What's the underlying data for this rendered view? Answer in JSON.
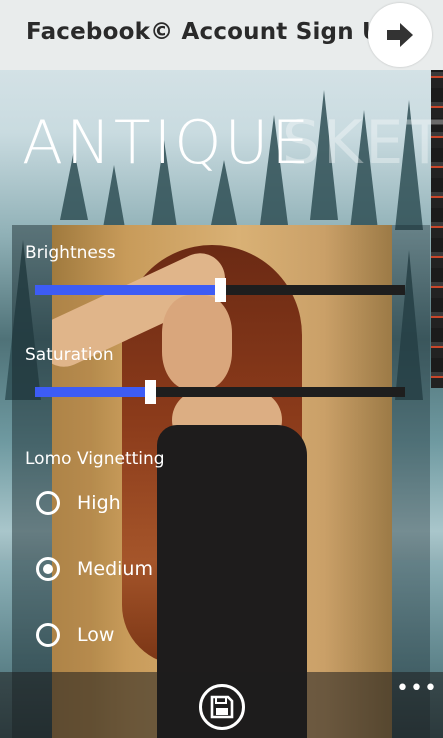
{
  "header": {
    "title": "Facebook© Account Sign Up",
    "next_icon": "arrow-right-icon"
  },
  "branding": {
    "logo_text": "ANTIQUE",
    "logo_faded_text": "SKETC"
  },
  "controls": {
    "brightness": {
      "label": "Brightness",
      "value": 0.5
    },
    "saturation": {
      "label": "Saturation",
      "value": 0.31
    },
    "vignetting": {
      "label": "Lomo Vignetting",
      "options": [
        "High",
        "Medium",
        "Low"
      ],
      "selected": "Medium"
    }
  },
  "appbar": {
    "save_icon": "save-icon",
    "more_label": "•••"
  },
  "colors": {
    "accent": "#3d5cf5",
    "track": "#1e1e1e",
    "topbar": "#e9ecec"
  }
}
